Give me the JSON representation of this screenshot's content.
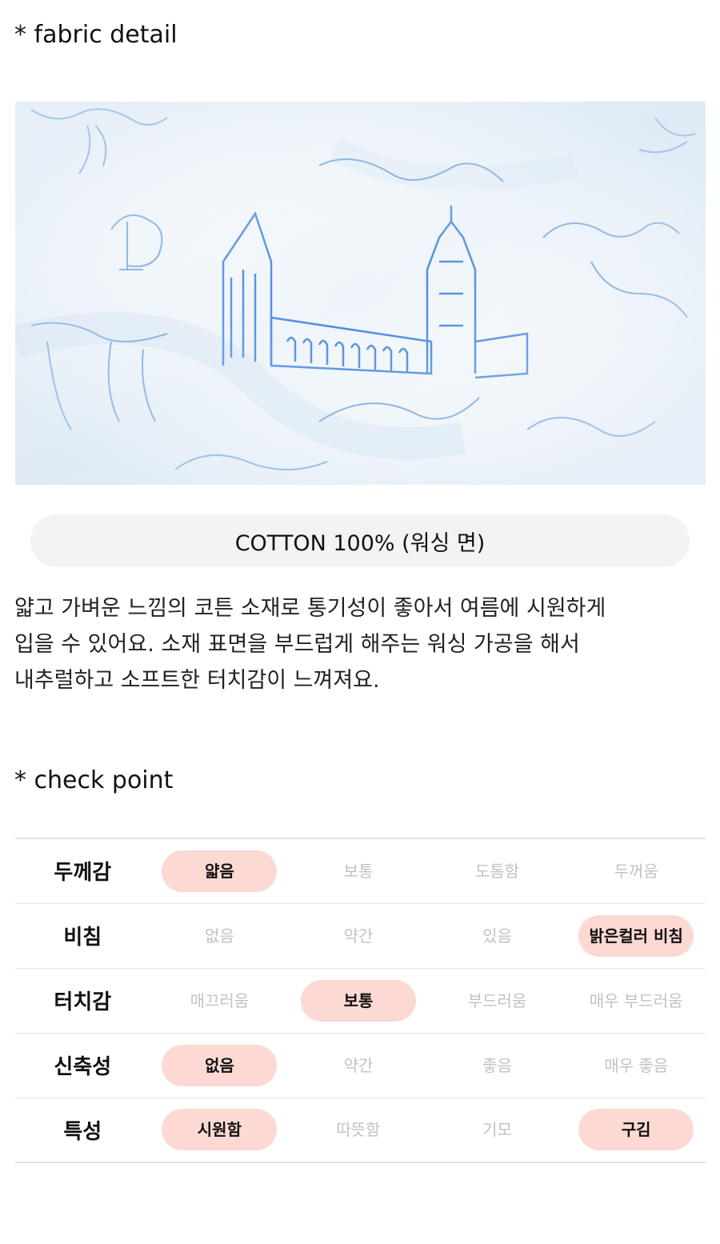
{
  "fabric_detail": {
    "title": "* fabric detail",
    "composition": "COTTON 100% (워싱 면)",
    "description_lines": [
      "얇고 가벼운 느낌의 코튼 소재로 통기성이 좋아서 여름에 시원하게",
      "입을 수 있어요. 소재 표면을 부드럽게 해주는 워싱 가공을 해서",
      "내추럴하고 소프트한 터치감이 느껴져요."
    ]
  },
  "check_point": {
    "title": "* check point",
    "rows": [
      {
        "label": "두께감",
        "options": [
          {
            "text": "얇음",
            "selected": true
          },
          {
            "text": "보통",
            "selected": false
          },
          {
            "text": "도톰함",
            "selected": false
          },
          {
            "text": "두꺼움",
            "selected": false
          }
        ]
      },
      {
        "label": "비침",
        "options": [
          {
            "text": "없음",
            "selected": false
          },
          {
            "text": "약간",
            "selected": false
          },
          {
            "text": "있음",
            "selected": false
          },
          {
            "text": "밝은컬러 비침",
            "selected": true
          }
        ]
      },
      {
        "label": "터치감",
        "options": [
          {
            "text": "매끄러움",
            "selected": false
          },
          {
            "text": "보통",
            "selected": true
          },
          {
            "text": "부드러움",
            "selected": false
          },
          {
            "text": "매우 부드러움",
            "selected": false
          }
        ]
      },
      {
        "label": "신축성",
        "options": [
          {
            "text": "없음",
            "selected": true
          },
          {
            "text": "약간",
            "selected": false
          },
          {
            "text": "좋음",
            "selected": false
          },
          {
            "text": "매우 좋음",
            "selected": false
          }
        ]
      },
      {
        "label": "특성",
        "options": [
          {
            "text": "시원함",
            "selected": true
          },
          {
            "text": "따뜻함",
            "selected": false
          },
          {
            "text": "기모",
            "selected": false
          },
          {
            "text": "구김",
            "selected": true
          }
        ]
      }
    ]
  },
  "colors": {
    "selected_pill": "#fcd9d2",
    "composition_pill": "#f3f3f3",
    "print_blue": "#3f82d8",
    "fabric_base": "#f1f6fb"
  }
}
